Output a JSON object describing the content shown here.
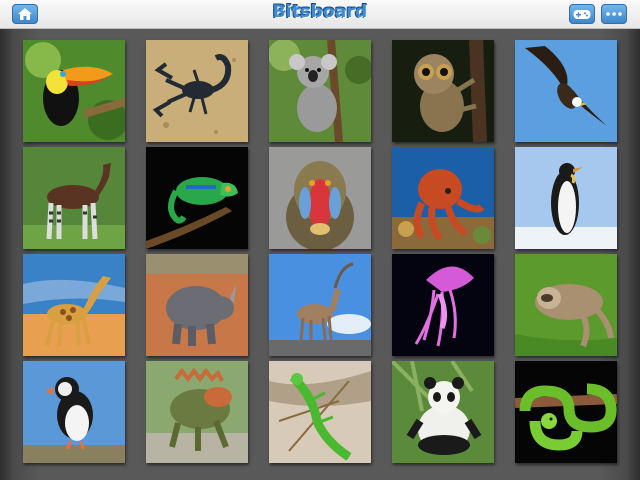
{
  "app": {
    "title": "Bitsboard"
  },
  "toolbar": {
    "home_icon": "home-icon",
    "games_icon": "gamepad-icon",
    "more_icon": "ellipsis-icon"
  },
  "colors": {
    "accent": "#3d8bd3",
    "background": "#5a5a5a"
  },
  "tiles": [
    {
      "subject": "toucan"
    },
    {
      "subject": "scorpion"
    },
    {
      "subject": "koala"
    },
    {
      "subject": "tarsier"
    },
    {
      "subject": "bald-eagle"
    },
    {
      "subject": "okapi"
    },
    {
      "subject": "chameleon"
    },
    {
      "subject": "mandrill"
    },
    {
      "subject": "octopus"
    },
    {
      "subject": "penguin"
    },
    {
      "subject": "giraffe"
    },
    {
      "subject": "rhinoceros"
    },
    {
      "subject": "ibex"
    },
    {
      "subject": "jellyfish"
    },
    {
      "subject": "sloth"
    },
    {
      "subject": "puffin"
    },
    {
      "subject": "iguana"
    },
    {
      "subject": "basilisk-lizard"
    },
    {
      "subject": "panda"
    },
    {
      "subject": "green-python"
    }
  ]
}
